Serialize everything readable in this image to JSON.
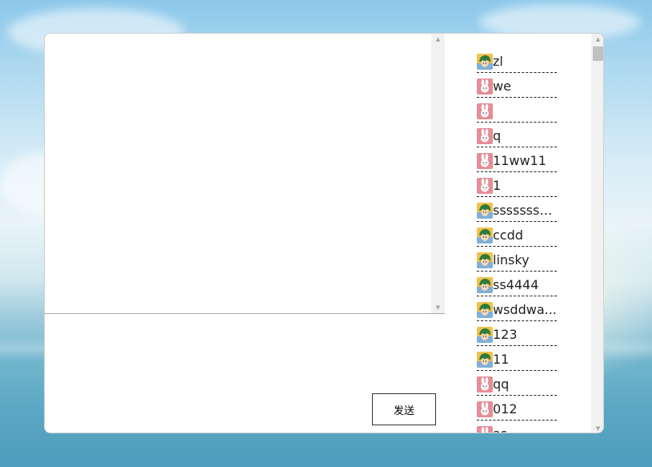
{
  "chat": {
    "send_label": "发送"
  },
  "users": [
    {
      "name": "zl",
      "avatar": "boy-avatar-icon"
    },
    {
      "name": "we",
      "avatar": "rabbit-avatar-icon"
    },
    {
      "name": "",
      "avatar": "rabbit-avatar-icon"
    },
    {
      "name": "q",
      "avatar": "rabbit-avatar-icon"
    },
    {
      "name": "11ww11",
      "avatar": "rabbit-avatar-icon"
    },
    {
      "name": "1",
      "avatar": "rabbit-avatar-icon"
    },
    {
      "name": "sssssssc...",
      "avatar": "boy-avatar-icon"
    },
    {
      "name": "ccdd",
      "avatar": "boy-avatar-icon"
    },
    {
      "name": "linsky",
      "avatar": "boy-avatar-icon"
    },
    {
      "name": "ss4444",
      "avatar": "boy-avatar-icon"
    },
    {
      "name": "wsddwa...",
      "avatar": "boy-avatar-icon"
    },
    {
      "name": "123",
      "avatar": "boy-avatar-icon"
    },
    {
      "name": "11",
      "avatar": "boy-avatar-icon"
    },
    {
      "name": "qq",
      "avatar": "rabbit-avatar-icon"
    },
    {
      "name": "012",
      "avatar": "rabbit-avatar-icon"
    },
    {
      "name": "as",
      "avatar": "rabbit-avatar-icon"
    }
  ],
  "colors": {
    "border": "#cfcfcf",
    "scrollbar_track": "#f1f1f1",
    "scrollbar_thumb": "#c1c1c1",
    "rabbit_avatar_bg": "#e58d96",
    "boy_avatar_bg": "#f0c24c"
  }
}
